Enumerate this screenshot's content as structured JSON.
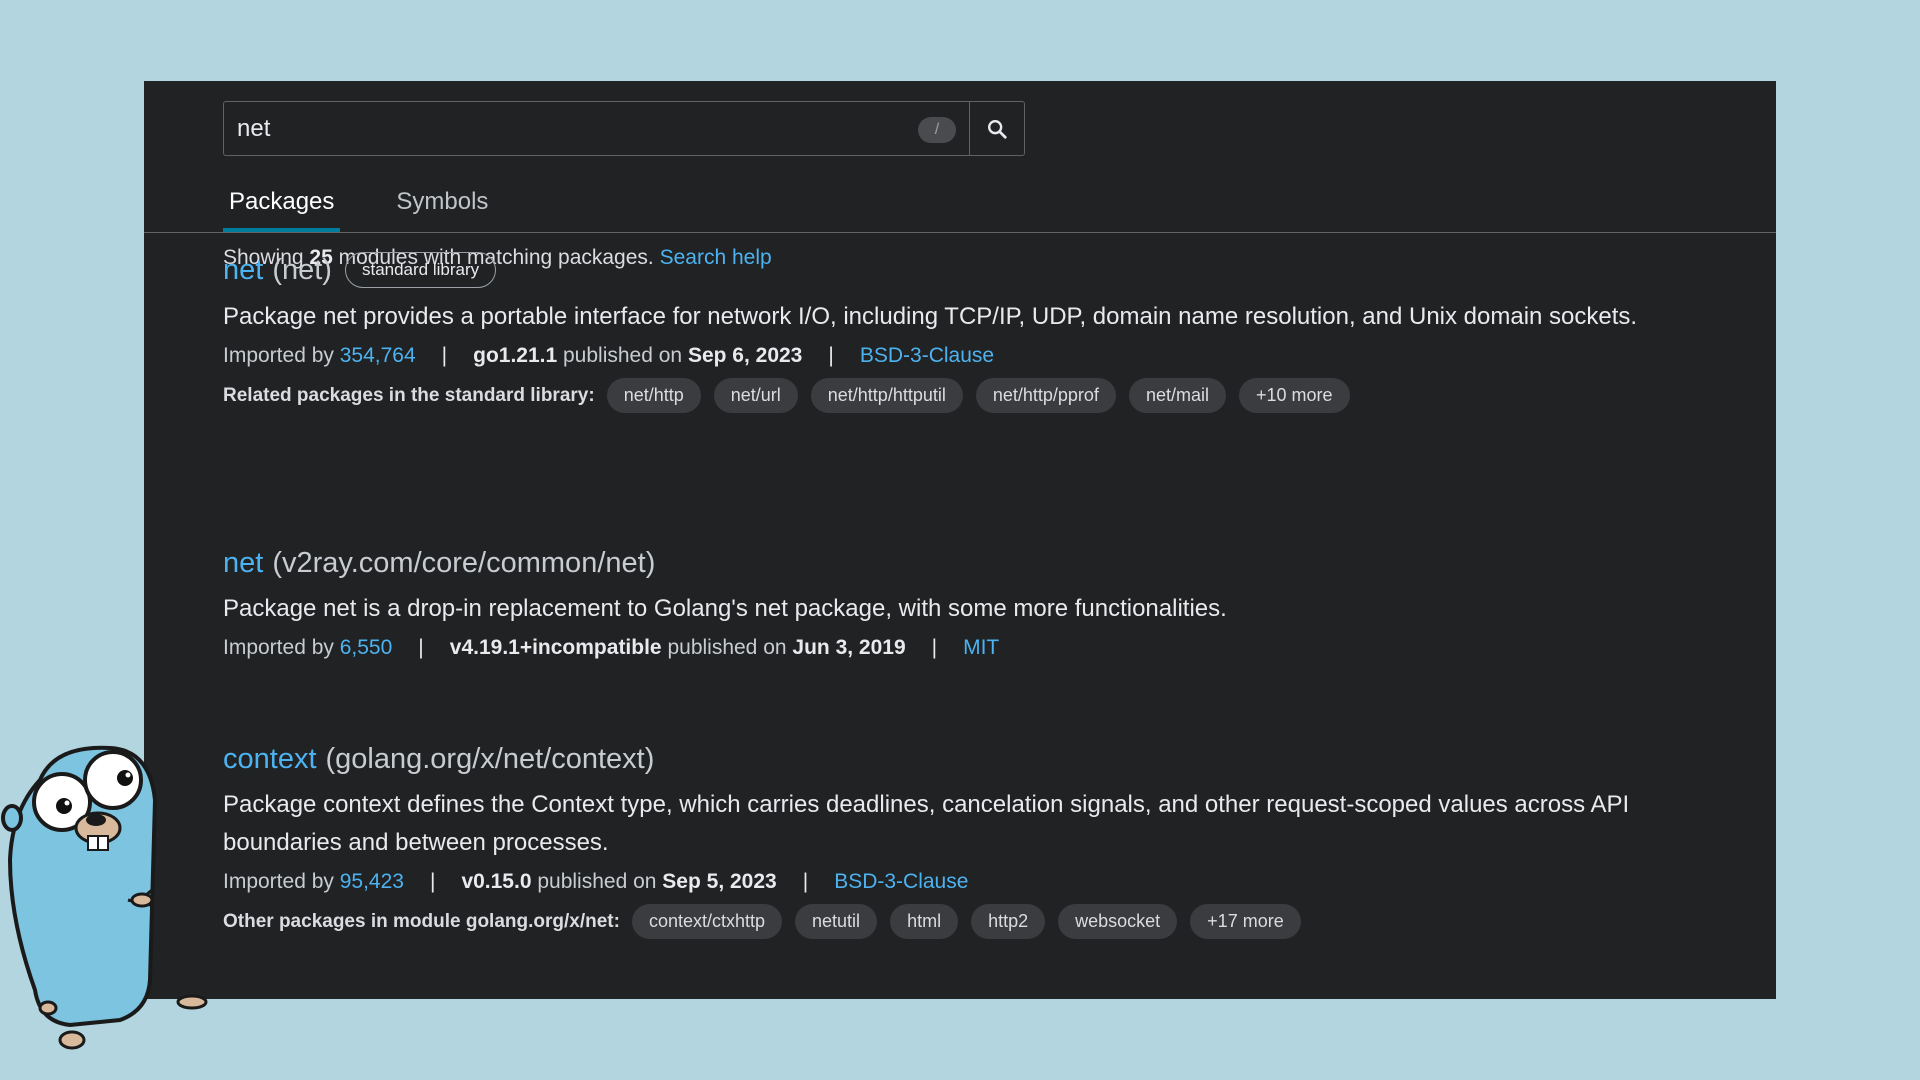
{
  "search": {
    "query": "net",
    "shortcut": "/",
    "button_icon": "search-icon"
  },
  "tabs": [
    {
      "label": "Packages",
      "active": true
    },
    {
      "label": "Symbols",
      "active": false
    }
  ],
  "summary": {
    "prefix": "Showing ",
    "count": "25",
    "suffix": " modules with matching packages. ",
    "help_link": "Search help"
  },
  "results": [
    {
      "name": "net",
      "path": "(net)",
      "badge": "standard library",
      "description": "Package net provides a portable interface for network I/O, including TCP/IP, UDP, domain name resolution, and Unix domain sockets.",
      "imported_label": "Imported by ",
      "imported_by": "354,764",
      "version": "go1.21.1",
      "published_label": " published on ",
      "date": "Sep 6, 2023",
      "license": "BSD-3-Clause",
      "chips_label": "Related packages in the standard library:",
      "chips": [
        "net/http",
        "net/url",
        "net/http/httputil",
        "net/http/pprof",
        "net/mail",
        "+10 more"
      ]
    },
    {
      "name": "net",
      "path": "(v2ray.com/core/common/net)",
      "description": "Package net is a drop-in replacement to Golang's net package, with some more functionalities.",
      "imported_label": "Imported by ",
      "imported_by": "6,550",
      "version": "v4.19.1+incompatible",
      "published_label": " published on ",
      "date": "Jun 3, 2019",
      "license": "MIT"
    },
    {
      "name": "context",
      "path": "(golang.org/x/net/context)",
      "description": "Package context defines the Context type, which carries deadlines, cancelation signals, and other request-scoped values across API boundaries and between processes.",
      "imported_label": "Imported by ",
      "imported_by": "95,423",
      "version": "v0.15.0",
      "published_label": " published on ",
      "date": "Sep 5, 2023",
      "license": "BSD-3-Clause",
      "chips_label": "Other packages in module golang.org/x/net:",
      "chips": [
        "context/ctxhttp",
        "netutil",
        "html",
        "http2",
        "websocket",
        "+17 more"
      ]
    }
  ],
  "separator": "|",
  "colors": {
    "link": "#4db3f0",
    "accent_tab": "#007d9c",
    "panel_bg": "#202224",
    "page_bg": "#b2d5e0",
    "gopher": "#7dc4e0"
  },
  "mascot": "gopher-mascot"
}
